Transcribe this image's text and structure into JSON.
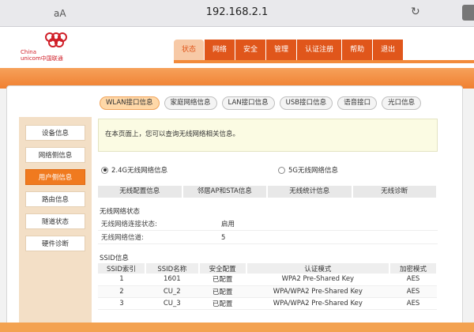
{
  "browser": {
    "aa": "aA",
    "url": "192.168.2.1"
  },
  "brand": {
    "line1": "China",
    "line2": "unicom中国联通",
    "color": "#d01f28"
  },
  "nav": {
    "items": [
      "状态",
      "网络",
      "安全",
      "管理",
      "认证注册",
      "帮助",
      "退出"
    ],
    "active": "状态"
  },
  "subtabs": {
    "items": [
      "WLAN接口信息",
      "家庭网络信息",
      "LAN接口信息",
      "USB接口信息",
      "语音接口",
      "光口信息"
    ],
    "active": "WLAN接口信息"
  },
  "sidebar": {
    "items": [
      "设备信息",
      "网络侧信息",
      "用户侧信息",
      "路由信息",
      "隧道状态",
      "硬件诊断"
    ],
    "active": "用户侧信息"
  },
  "info": {
    "text": "在本页面上，您可以查询无线网络相关信息。"
  },
  "radios": {
    "band24": "2.4G无线网络信息",
    "band5": "5G无线网络信息"
  },
  "tabbar": {
    "items": [
      "无线配置信息",
      "邻居AP和STA信息",
      "无线统计信息",
      "无线诊断"
    ]
  },
  "wireless_status": {
    "title": "无线网络状态",
    "rows": [
      {
        "label": "无线网络连接状态:",
        "value": "启用"
      },
      {
        "label": "无线网络信道:",
        "value": "5"
      }
    ]
  },
  "ssid": {
    "title": "SSID信息",
    "headers": [
      "SSID索引",
      "SSID名称",
      "安全配置",
      "认证模式",
      "加密模式"
    ],
    "rows": [
      [
        "1",
        "1601",
        "已配置",
        "WPA2 Pre-Shared Key",
        "AES"
      ],
      [
        "2",
        "CU_2",
        "已配置",
        "WPA/WPA2 Pre-Shared Key",
        "AES"
      ],
      [
        "3",
        "CU_3",
        "已配置",
        "WPA/WPA2 Pre-Shared Key",
        "AES"
      ]
    ]
  },
  "colors": {
    "accent": "#f07a1f",
    "nav": "#e0561b",
    "sidebar": "#f3dfc6"
  }
}
